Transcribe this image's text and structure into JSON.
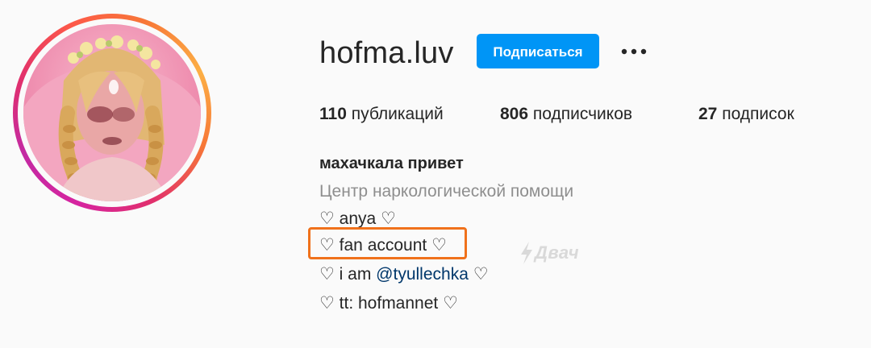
{
  "profile": {
    "username": "hofma.luv",
    "follow_label": "Подписаться",
    "more_label": "•••"
  },
  "stats": {
    "posts_count": "110",
    "posts_label": "публикаций",
    "followers_count": "806",
    "followers_label": "подписчиков",
    "following_count": "27",
    "following_label": "подписок"
  },
  "bio": {
    "name": "махачкала привет",
    "category": "Центр наркологической помощи",
    "line1": "♡ anya ♡",
    "line2": "♡ fan account ♡",
    "line3_prefix": "♡ i am ",
    "line3_mention": "@tyullechka",
    "line3_suffix": " ♡",
    "line4": "♡ tt: hofmannet ♡"
  },
  "watermark": {
    "text": "Двач"
  },
  "colors": {
    "follow_button": "#0095f6",
    "highlight_box": "#f0711b",
    "mention": "#00376b",
    "category_text": "#8e8e8e"
  }
}
